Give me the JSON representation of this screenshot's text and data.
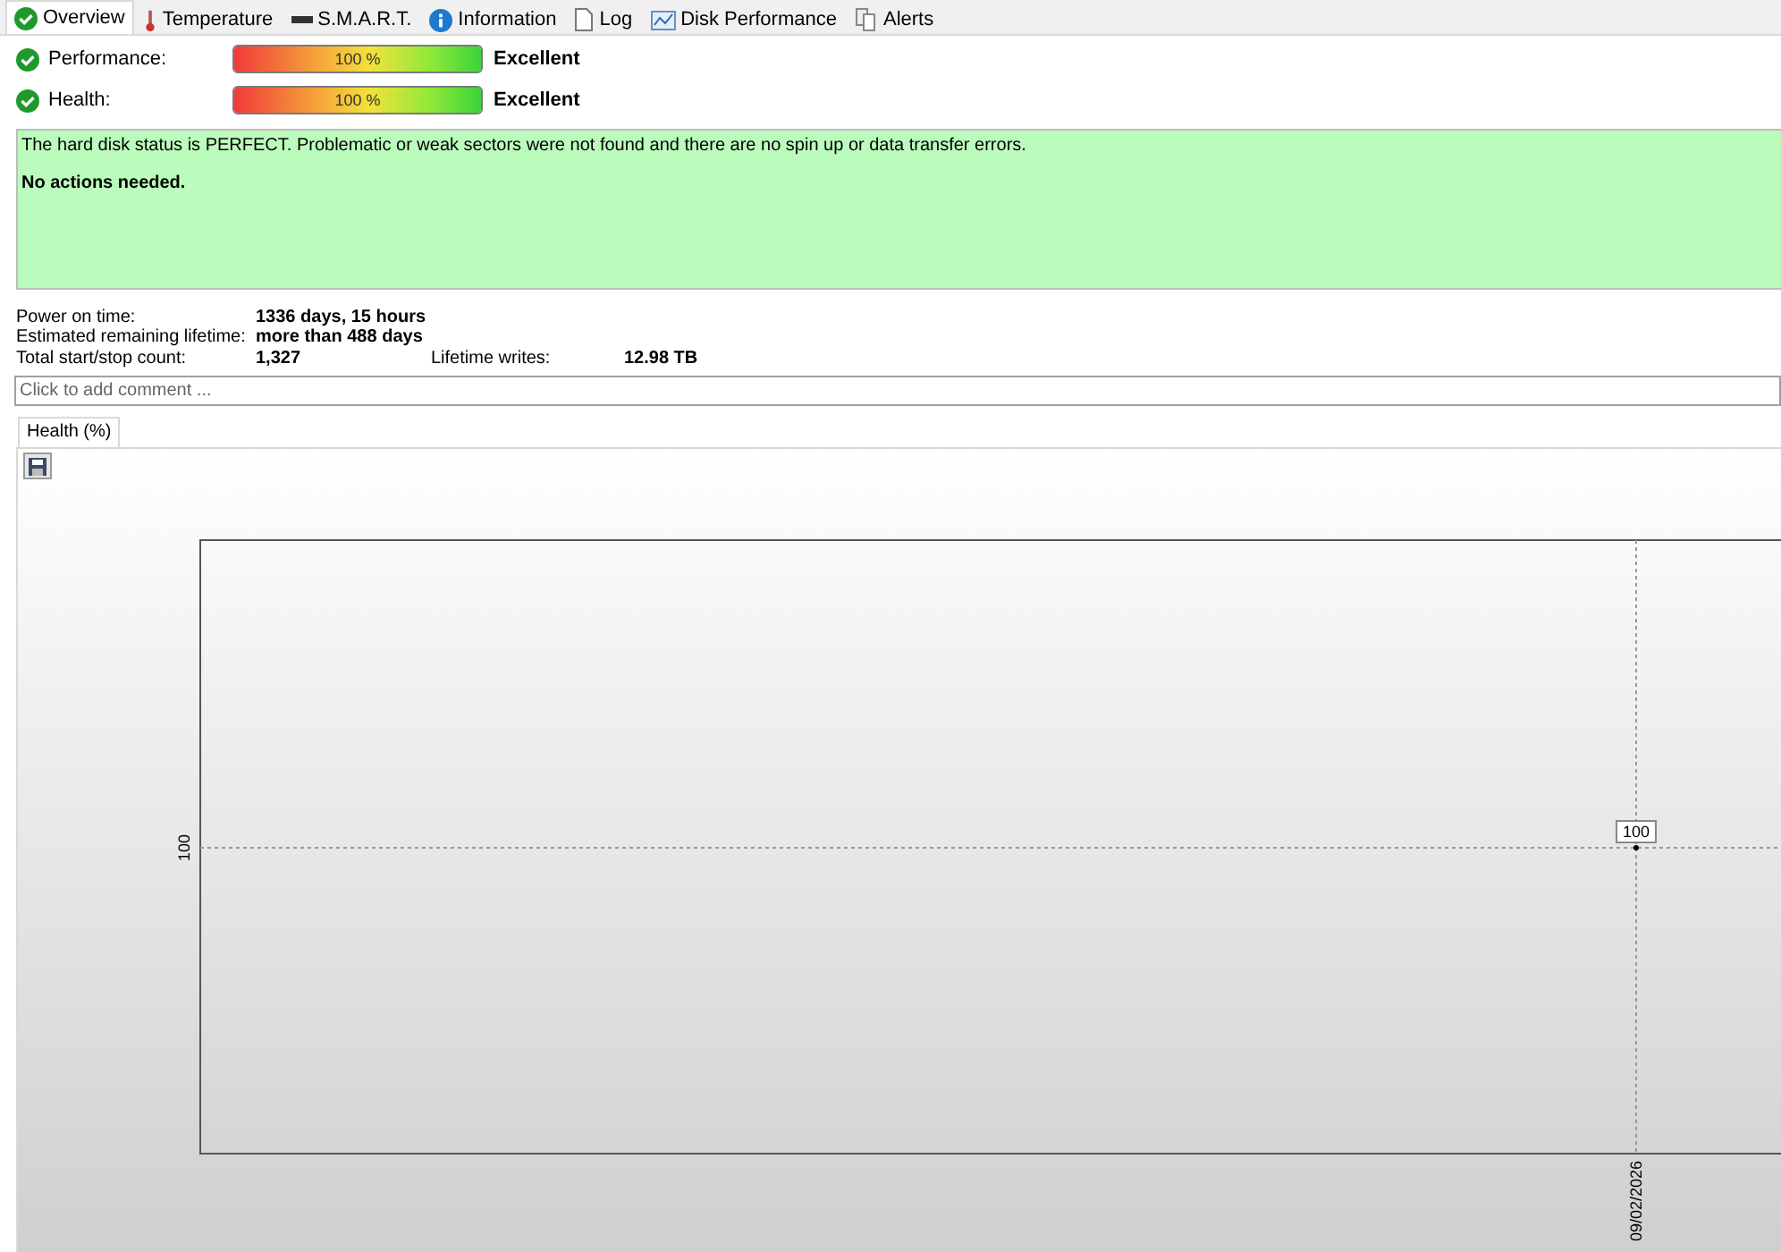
{
  "tabs": [
    {
      "label": "Overview",
      "selected": true
    },
    {
      "label": "Temperature",
      "selected": false
    },
    {
      "label": "S.M.A.R.T.",
      "selected": false
    },
    {
      "label": "Information",
      "selected": false
    },
    {
      "label": "Log",
      "selected": false
    },
    {
      "label": "Disk Performance",
      "selected": false
    },
    {
      "label": "Alerts",
      "selected": false
    }
  ],
  "meters": [
    {
      "label": "Performance:",
      "level": 1,
      "reading": "100 %",
      "rating": "Excellent"
    },
    {
      "label": "Health:",
      "level": 1,
      "reading": "100 %",
      "rating": "Excellent"
    }
  ],
  "status": {
    "message": "The hard disk status is PERFECT. Problematic or weak sectors were not found and there are no spin up or data transfer errors.",
    "action": "No actions needed."
  },
  "info": [
    {
      "label": "Power on time:",
      "value": "1336 days, 15 hours"
    },
    {
      "label": "Estimated remaining lifetime:",
      "value": "more than 488 days"
    },
    {
      "label": "Total start/stop count:",
      "value": "1,327",
      "label_2": "Lifetime writes:",
      "value_2": "12.98 TB"
    }
  ],
  "comment": {
    "placeholder": "Click to add comment ..."
  },
  "chart_tabs": [
    {
      "label": "Health (%)",
      "selected": true
    }
  ],
  "chart": {
    "y_label": "100",
    "x_label": "09/02/2026",
    "point_label": "100"
  }
}
